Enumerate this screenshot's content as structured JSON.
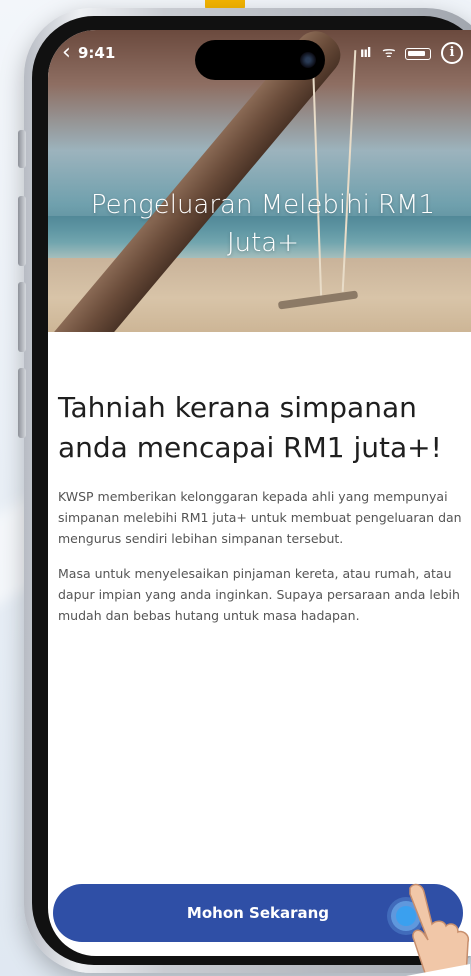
{
  "status_bar": {
    "back_glyph": "‹",
    "time": "9:41",
    "signal_glyph": "ııl",
    "wifi_glyph": "ᯤ",
    "info_glyph": "i"
  },
  "hero": {
    "title": "Pengeluaran Melebihi RM1 Juta+"
  },
  "main": {
    "heading": "Tahniah kerana simpanan anda mencapai RM1 juta+!",
    "paragraphs": [
      "KWSP memberikan kelonggaran kepada ahli yang mempunyai simpanan melebihi RM1 juta+ untuk membuat pengeluaran dan mengurus sendiri lebihan simpanan tersebut.",
      "Masa untuk menyelesaikan pinjaman kereta, atau rumah, atau dapur impian yang anda inginkan. Supaya persaraan anda lebih mudah dan bebas hutang untuk masa hadapan."
    ]
  },
  "cta": {
    "label": "Mohon Sekarang"
  },
  "colors": {
    "primary_button": "#2f4fa6",
    "tap_indicator": "#3aa0ef",
    "heading_text": "#1f1f1f",
    "body_text": "#555555"
  },
  "icons": [
    "back-chevron-icon",
    "signal-icon",
    "wifi-icon",
    "battery-icon",
    "info-icon",
    "tap-hand-icon"
  ]
}
